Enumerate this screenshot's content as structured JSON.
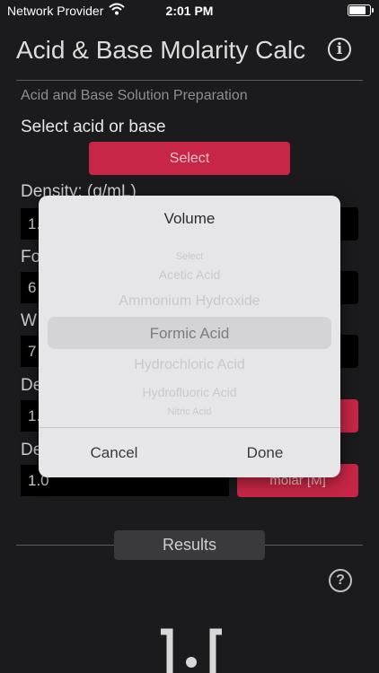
{
  "status_bar": {
    "carrier": "Network Provider",
    "time": "2:01 PM",
    "battery_level": 0.9
  },
  "header": {
    "title": "Acid & Base Molarity Calc",
    "info_icon": "info-icon"
  },
  "section": {
    "subtitle": "Acid and Base Solution Preparation",
    "select_label": "Select acid or base",
    "select_button": "Select"
  },
  "fields": {
    "density_label": "Density:  (g/mL)",
    "density_value": "1.",
    "formula_label": "Fo",
    "formula_value": "6",
    "weight_label": "W",
    "weight_value": "7",
    "desired_label": "De",
    "desired_value": "1.",
    "desired2_label": "De",
    "desired2_value": "1.0",
    "unit_button": "molar [M]"
  },
  "results": {
    "label": "Results"
  },
  "picker_modal": {
    "title": "Volume",
    "options": [
      "Select",
      "Acetic Acid",
      "Ammonium Hydroxide",
      "Formic Acid",
      "Hydrochloric Acid",
      "Hydrofluoric Acid",
      "Nitric Acid"
    ],
    "selected": "Formic Acid",
    "cancel": "Cancel",
    "done": "Done"
  },
  "colors": {
    "accent": "#c72646",
    "background": "#1b1b1d",
    "modal": "#e6e6e9"
  }
}
